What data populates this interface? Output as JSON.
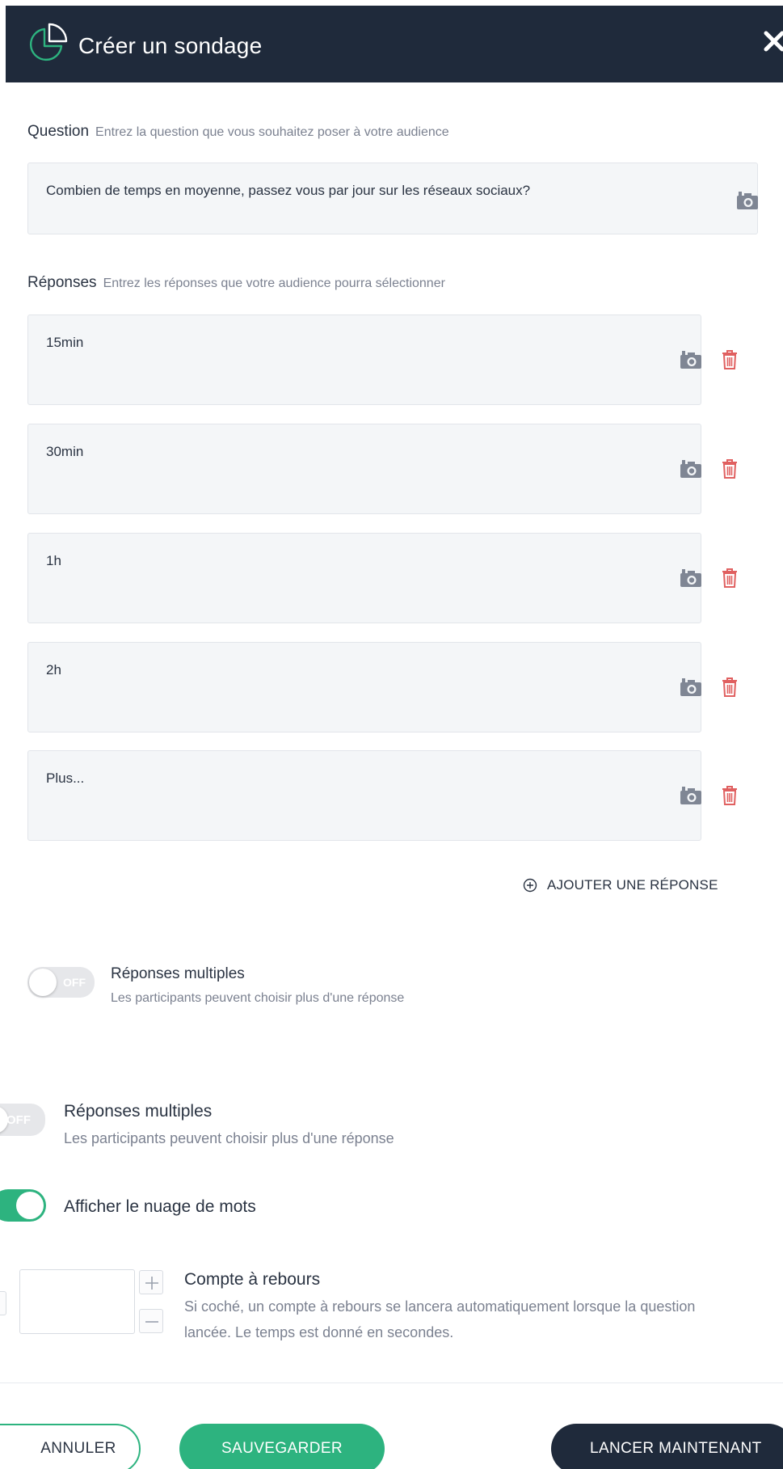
{
  "header": {
    "title": "Créer un sondage",
    "logo_icon": "pie-chart-icon",
    "close_icon": "close-icon"
  },
  "question": {
    "label": "Question",
    "hint": "Entrez la question que vous souhaitez poser à votre audience",
    "value": "Combien de temps en moyenne, passez vous par jour sur les réseaux sociaux?"
  },
  "answers": {
    "label": "Réponses",
    "hint": "Entrez les réponses que votre audience pourra sélectionner",
    "items": [
      {
        "value": "15min"
      },
      {
        "value": "30min"
      },
      {
        "value": "1h"
      },
      {
        "value": "2h"
      },
      {
        "value": "Plus..."
      }
    ],
    "add_label": "AJOUTER UNE RÉPONSE"
  },
  "multiple_small": {
    "toggle": "OFF",
    "title": "Réponses multiples",
    "desc": "Les participants peuvent choisir plus d'une réponse"
  },
  "multiple_large": {
    "toggle": "OFF",
    "title": "Réponses multiples",
    "desc": "Les participants peuvent choisir plus d'une réponse"
  },
  "wordcloud": {
    "enabled": true,
    "title": "Afficher le nuage de mots"
  },
  "countdown": {
    "title": "Compte à rebours",
    "desc_line1": "Si coché, un compte à rebours se lancera automatiquement lorsque la question",
    "desc_line2": "lancée. Le temps est donné en secondes."
  },
  "footer": {
    "cancel": "ANNULER",
    "save": "SAUVEGARDER",
    "launch": "LANCER MAINTENANT"
  },
  "colors": {
    "accent": "#2db37f",
    "dark": "#1f2a3b",
    "danger": "#e06060",
    "field_bg": "#f4f6f8"
  }
}
